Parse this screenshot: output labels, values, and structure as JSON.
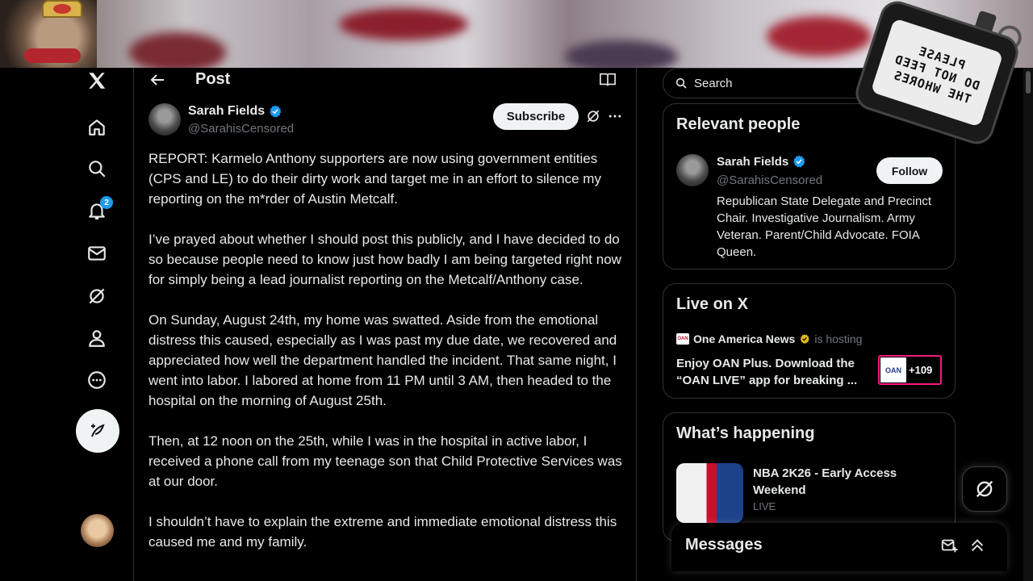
{
  "header": {
    "title": "Post"
  },
  "nav": {
    "notification_count": "2"
  },
  "post": {
    "author_name": "Sarah Fields",
    "author_handle": "@SarahisCensored",
    "subscribe_label": "Subscribe",
    "paragraphs": [
      "REPORT: Karmelo Anthony supporters are now using government entities (CPS and LE) to do their dirty work and target me in an effort to silence my reporting on the m*rder of Austin Metcalf.",
      "I’ve prayed about whether I should post this publicly, and I have decided to do so because people need to know just how badly I am being targeted right now for simply being a lead journalist reporting on the Metcalf/Anthony case.",
      "On Sunday, August 24th, my home was swatted. Aside from the emotional distress this caused, especially as I was past my due date, we recovered and appreciated how well the department handled the incident. That same night, I went into labor. I labored at home from 11 PM until 3 AM, then headed to the hospital on the morning of August 25th.",
      "Then, at 12 noon on the 25th, while I was in the hospital in active labor, I received a phone call from my teenage son that Child Protective Services was at our door.",
      "I shouldn’t have to explain the extreme and immediate emotional distress this caused me and my family."
    ]
  },
  "search": {
    "placeholder": "Search"
  },
  "relevant_people": {
    "title": "Relevant people",
    "name": "Sarah Fields",
    "handle": "@SarahisCensored",
    "follow_label": "Follow",
    "bio": "Republican State Delegate and Precinct Chair. Investigative Journalism. Army Veteran. Parent/Child Advocate. FOIA Queen."
  },
  "live": {
    "title": "Live on X",
    "host_name": "One America News",
    "host_label": "is hosting",
    "description": "Enjoy OAN Plus. Download the “OAN LIVE” app for breaking ...",
    "thumb_logo": "OAN",
    "listener_count": "+109"
  },
  "happening": {
    "title": "What’s happening",
    "trend_title": "NBA 2K26 - Early Access Weekend",
    "trend_status": "LIVE"
  },
  "messages": {
    "title": "Messages"
  },
  "sticker": {
    "lines": [
      "PLEASE",
      "DO NOT FEED",
      "THE WHORES"
    ]
  },
  "colors": {
    "accent": "#1d9bf0",
    "verified": "#1d9bf0",
    "live_border": "#f91880",
    "gold": "#e2b719"
  },
  "icons": [
    "x-logo-icon",
    "home-icon",
    "search-icon",
    "bell-icon",
    "mail-icon",
    "grok-icon",
    "profile-icon",
    "more-circle-icon",
    "compose-icon"
  ]
}
